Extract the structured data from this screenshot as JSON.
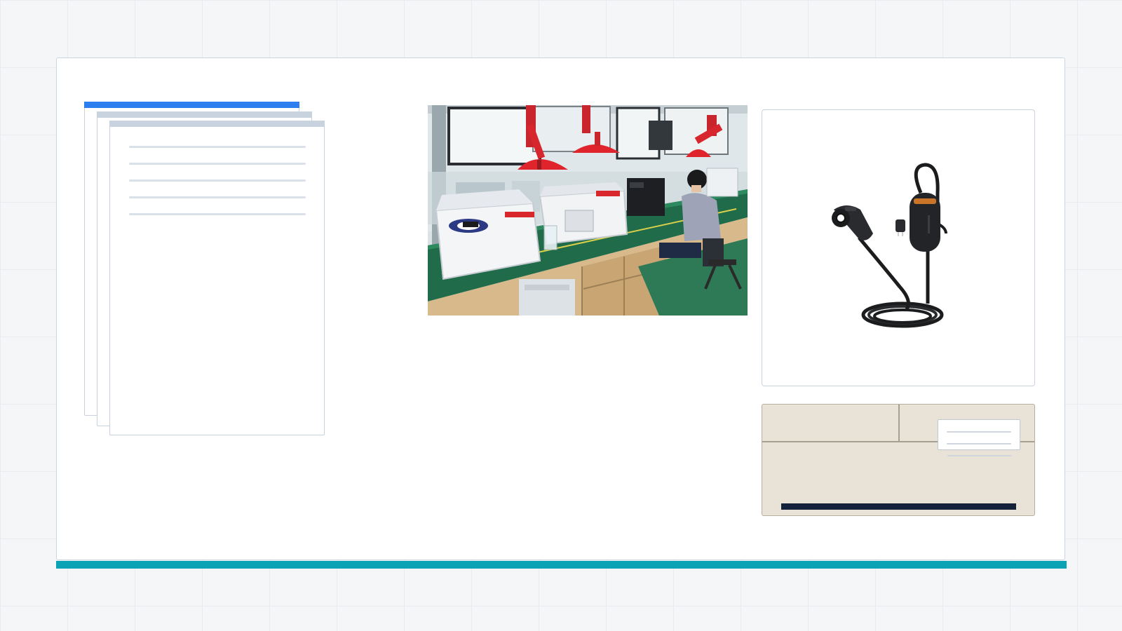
{
  "colors": {
    "page_background": "#f4f6f8",
    "card_background": "#ffffff",
    "accent_teal": "#0aa3b5",
    "accent_blue": "#2d7ff0",
    "sheet_cap_gray": "#c9d3df",
    "beige_panel": "#e9e2d6",
    "navy_bar": "#13213a"
  },
  "icons": {
    "documents": "document-stack-icon",
    "lab": "laboratory-photo",
    "product": "ev-charger-product",
    "panel": "label-panel"
  }
}
